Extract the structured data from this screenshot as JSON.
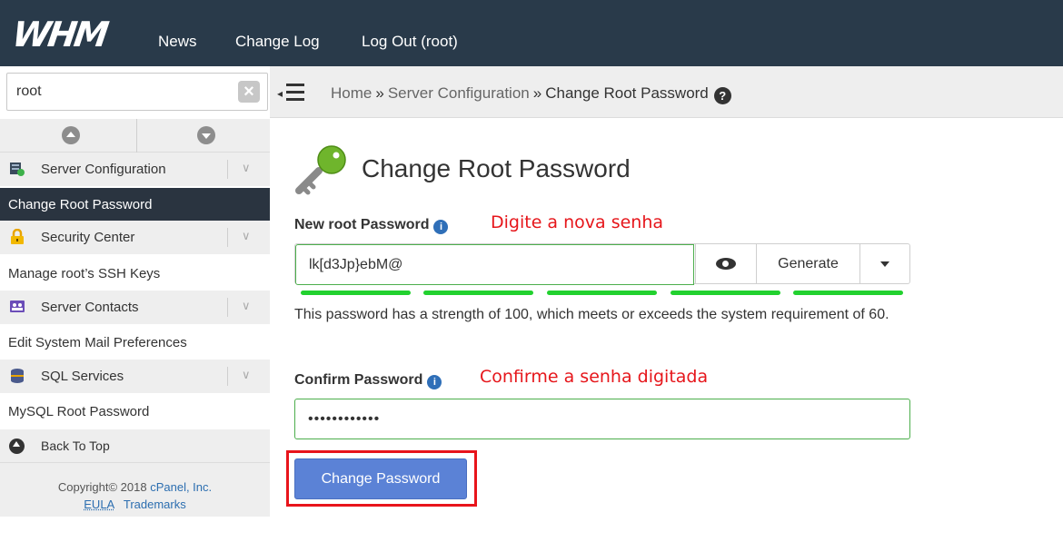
{
  "header": {
    "logo_text": "WHM",
    "nav": [
      "News",
      "Change Log",
      "Log Out (root)"
    ]
  },
  "sidebar": {
    "search_value": "root",
    "categories": [
      {
        "label": "Server Configuration",
        "icon": "server-config-icon",
        "item": "Change Root Password",
        "active": true
      },
      {
        "label": "Security Center",
        "icon": "lock-icon",
        "item": "Manage root’s SSH Keys",
        "active": false
      },
      {
        "label": "Server Contacts",
        "icon": "contacts-icon",
        "item": "Edit System Mail Preferences",
        "active": false
      },
      {
        "label": "SQL Services",
        "icon": "database-icon",
        "item": "MySQL Root Password",
        "active": false
      }
    ],
    "back_to_top": "Back To Top",
    "copyright_prefix": "Copyright© 2018 ",
    "copyright_link": "cPanel, Inc.",
    "footer_links": [
      "EULA",
      "Trademarks"
    ]
  },
  "breadcrumb": {
    "items": [
      "Home",
      "Server Configuration",
      "Change Root Password"
    ],
    "separator": "»"
  },
  "main": {
    "title": "Change Root Password",
    "new_password_label": "New root Password",
    "new_password_annotation": "Digite a nova senha",
    "new_password_value": "lk[d3Jp}ebM@",
    "generate_label": "Generate",
    "strength_text": "This password has a strength of 100, which meets or exceeds the system requirement of 60.",
    "strength": 100,
    "confirm_label": "Confirm Password",
    "confirm_annotation": "Confirme a senha digitada",
    "confirm_value": "••••••••••••",
    "submit_label": "Change Password"
  },
  "colors": {
    "topbar": "#293a4a",
    "active_item": "#2a3440",
    "strength_bar": "#22d12f",
    "annotation": "#e6161b",
    "button": "#5b82d6",
    "highlight_frame": "#e8141b"
  }
}
